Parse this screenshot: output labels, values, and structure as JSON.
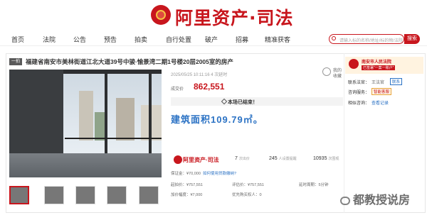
{
  "header": {
    "brand": "阿里资产·司法"
  },
  "nav": {
    "items": [
      "首页",
      "法院",
      "公告",
      "预告",
      "拍卖",
      "自行处置",
      "破产",
      "招募",
      "精准获客"
    ],
    "search_placeholder": "请输入标的名称/地址/标的物/法院",
    "search_button": "搜索"
  },
  "listing": {
    "badge": "一拍",
    "title": "福建省南安市美林街道江北大道39号中骏·愉景湾二期1号楼20层2005室的房产",
    "time": "2025/05/25 10:11:16  4 次延时",
    "deal_label": "成交价",
    "deal_price": "862,551",
    "ended": "本场已结束！",
    "area_text": "建筑面积109.79㎡。",
    "fav_label": "我的收藏",
    "logo": "阿里资产·司法",
    "stats": [
      {
        "value": "7",
        "label": "次出价"
      },
      {
        "value": "245",
        "label": "人设置提醒"
      },
      {
        "value": "10935",
        "label": "次围观"
      }
    ],
    "lines": [
      [
        "保证金：¥70,000",
        "如何使用贷款缴纳?"
      ],
      [
        "起拍价：¥757,551",
        "评估价：¥757,551",
        "延时周期：5分钟"
      ],
      [
        "加价幅度：¥7,000",
        "优先购买权人：0"
      ]
    ]
  },
  "court": {
    "name": "南安市人民法院",
    "tag": "已签署“一案一账户”",
    "contact_label": "联系法官：",
    "contact_name": "王法官",
    "contact_btn": "联系",
    "consult_label": "咨询服务：",
    "consult_btn": "智能客服",
    "inquiry_label": "相似咨询：",
    "inquiry_link": "查看记录"
  },
  "watermark": "都教授说房"
}
